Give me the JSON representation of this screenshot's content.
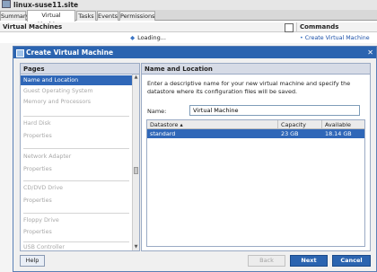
{
  "host": {
    "title": "linux-suse11.site",
    "icon": "server-icon"
  },
  "tabs": [
    {
      "label": "Summary"
    },
    {
      "label": "Virtual Machines"
    },
    {
      "label": "Tasks"
    },
    {
      "label": "Events"
    },
    {
      "label": "Permissions"
    }
  ],
  "active_tab": "Virtual Machines",
  "vm_panel": {
    "title": "Virtual Machines",
    "loading": "Loading..."
  },
  "commands": {
    "title": "Commands",
    "create": "Create Virtual Machine"
  },
  "dialog": {
    "title": "Create Virtual Machine",
    "close_label": "✕",
    "pages_title": "Pages",
    "pages": [
      {
        "label": "Name and Location",
        "selected": true
      },
      {
        "label": "Guest Operating System"
      },
      {
        "label": "Memory and Processors"
      },
      {
        "label": "Hard Disk"
      },
      {
        "label": "Properties"
      },
      {
        "label": "Network Adapter"
      },
      {
        "label": "Properties"
      },
      {
        "label": "CD/DVD Drive"
      },
      {
        "label": "Properties"
      },
      {
        "label": "Floppy Drive"
      },
      {
        "label": "Properties"
      },
      {
        "label": "USB Controller"
      }
    ],
    "section_title": "Name and Location",
    "description": "Enter a descriptive name for your new virtual machine and specify the datastore where its configuration files will be saved.",
    "name_label": "Name:",
    "name_value": "Virtual Machine",
    "datastore_columns": [
      "Datastore ▴",
      "Capacity",
      "Available"
    ],
    "datastores": [
      {
        "name": "standard",
        "capacity": "23 GB",
        "available": "18.14 GB",
        "selected": true
      }
    ],
    "buttons": {
      "help": "Help",
      "back": "Back",
      "next": "Next",
      "cancel": "Cancel"
    }
  },
  "colors": {
    "accent": "#2b64b0",
    "selection": "#2f67b8"
  }
}
